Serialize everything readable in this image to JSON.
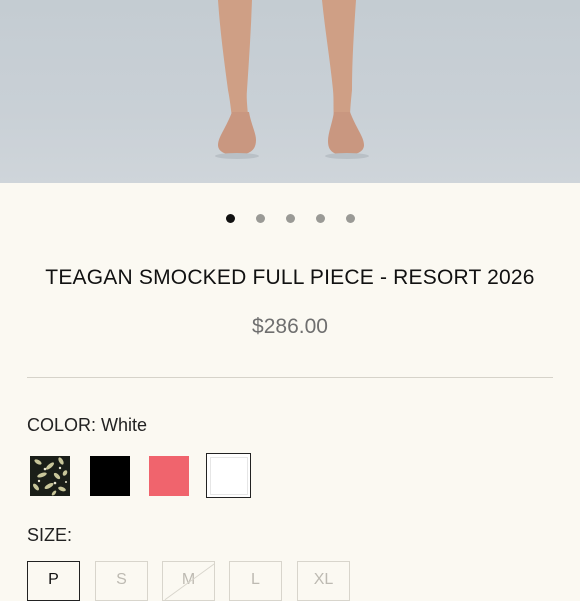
{
  "gallery": {
    "dot_count": 5,
    "active_index": 0
  },
  "product": {
    "title": "TEAGAN SMOCKED FULL PIECE - RESORT 2026",
    "price": "$286.00"
  },
  "color": {
    "label": "COLOR: White",
    "swatches": [
      {
        "name": "print",
        "value": "#1a1e18"
      },
      {
        "name": "black",
        "value": "#000000"
      },
      {
        "name": "coral",
        "value": "#f0646d"
      },
      {
        "name": "white",
        "value": "#ffffff",
        "selected": true
      }
    ]
  },
  "size": {
    "label": "SIZE:",
    "options": [
      {
        "label": "P",
        "selected": true,
        "available": true
      },
      {
        "label": "S",
        "selected": false,
        "available": true
      },
      {
        "label": "M",
        "selected": false,
        "available": false
      },
      {
        "label": "L",
        "selected": false,
        "available": true
      },
      {
        "label": "XL",
        "selected": false,
        "available": true
      }
    ]
  }
}
